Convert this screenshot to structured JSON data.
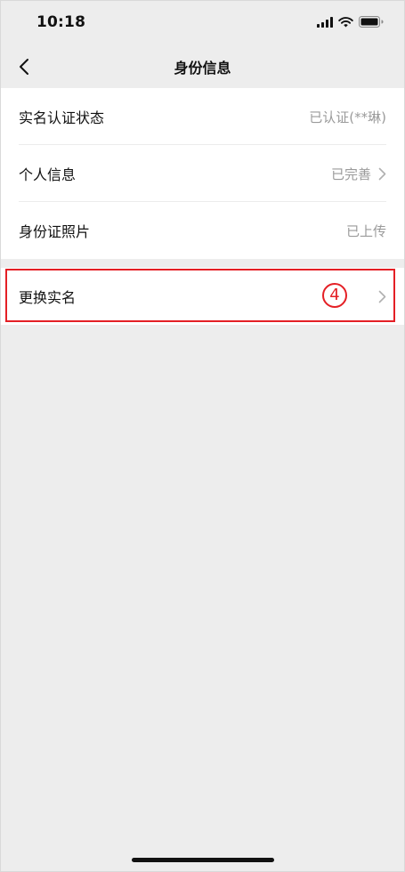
{
  "status_bar": {
    "time": "10:18",
    "icons": [
      "signal-icon",
      "wifi-icon",
      "battery-icon"
    ]
  },
  "nav": {
    "back_icon": "chevron-left-icon",
    "title": "身份信息"
  },
  "rows": [
    {
      "label": "实名认证状态",
      "value": "已认证(**琳)",
      "has_chevron": false
    },
    {
      "label": "个人信息",
      "value": "已完善",
      "has_chevron": true
    },
    {
      "label": "身份证照片",
      "value": "已上传",
      "has_chevron": false
    }
  ],
  "change_name": {
    "label": "更换实名",
    "has_chevron": true,
    "highlighted": true,
    "step_marker": "4"
  },
  "colors": {
    "background": "#ededed",
    "card": "#ffffff",
    "highlight": "#e41f25",
    "secondary_text": "#9a9a9a"
  }
}
